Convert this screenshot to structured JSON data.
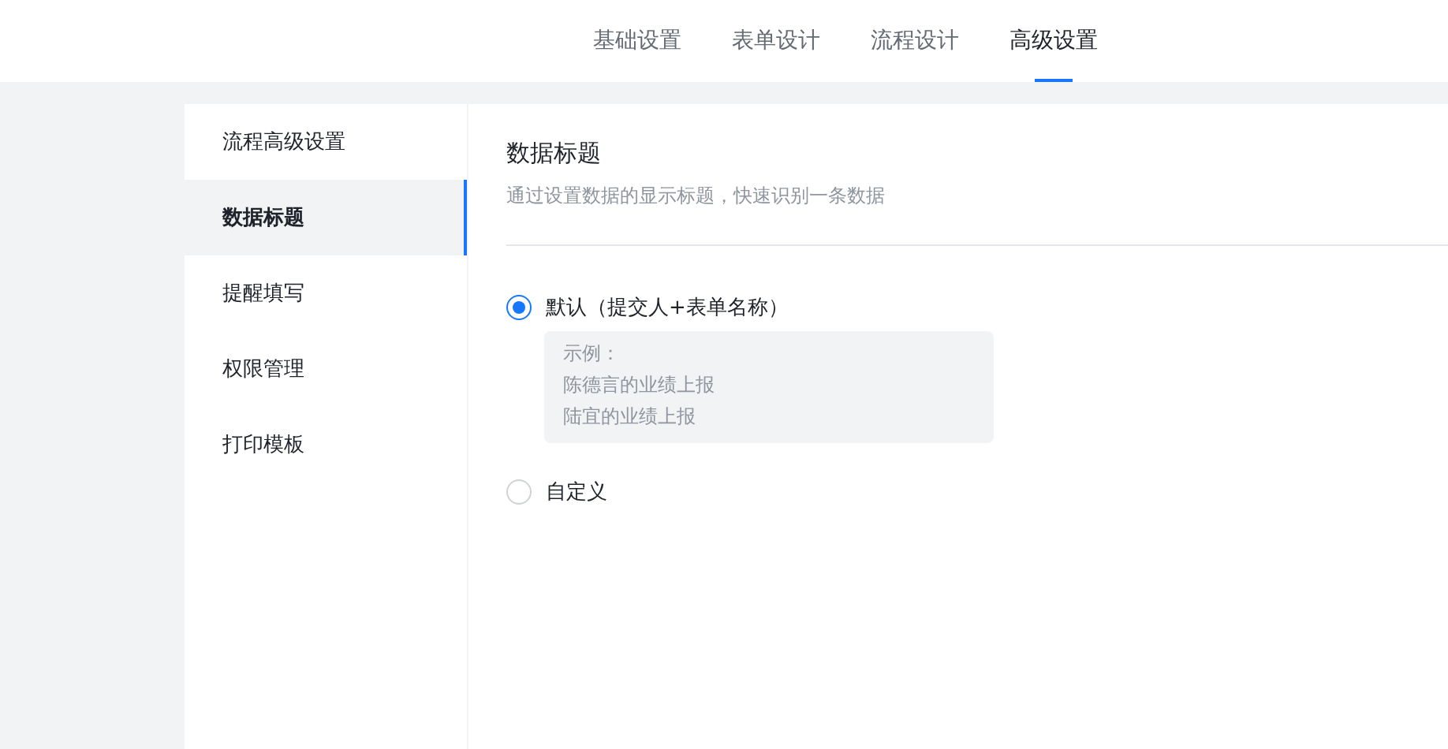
{
  "tabs": [
    {
      "label": "基础设置",
      "selected": false
    },
    {
      "label": "表单设计",
      "selected": false
    },
    {
      "label": "流程设计",
      "selected": false
    },
    {
      "label": "高级设置",
      "selected": true
    }
  ],
  "sidebar": {
    "items": [
      {
        "label": "流程高级设置",
        "selected": false
      },
      {
        "label": "数据标题",
        "selected": true
      },
      {
        "label": "提醒填写",
        "selected": false
      },
      {
        "label": "权限管理",
        "selected": false
      },
      {
        "label": "打印模板",
        "selected": false
      }
    ]
  },
  "section": {
    "title": "数据标题",
    "description": "通过设置数据的显示标题，快速识别一条数据",
    "options": [
      {
        "label": "默认（提交人+表单名称）",
        "selected": true,
        "example": [
          "示例：",
          "陈德言的业绩上报",
          "陆宜的业绩上报"
        ]
      },
      {
        "label": "自定义",
        "selected": false
      }
    ]
  }
}
